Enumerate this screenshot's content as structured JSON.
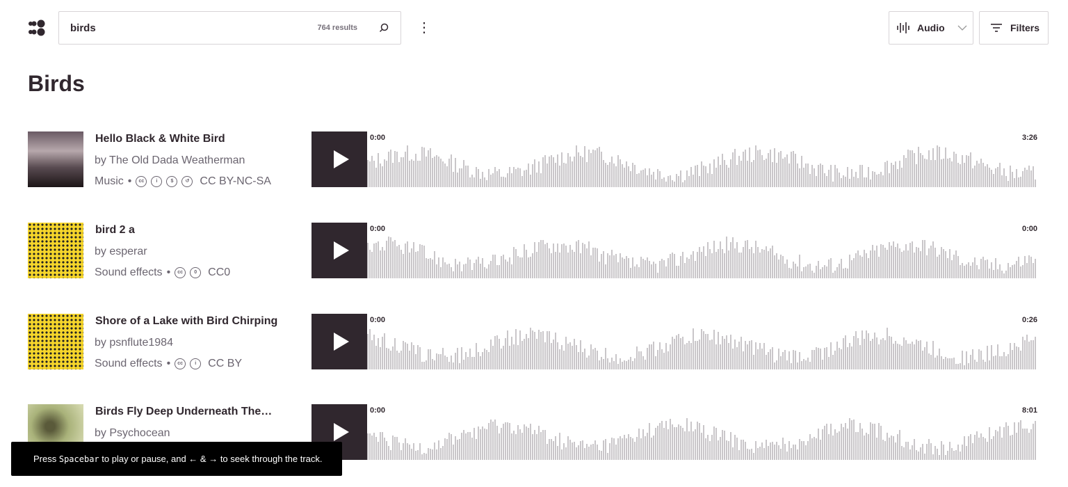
{
  "header": {
    "search_value": "birds",
    "result_count": "764 results",
    "content_type": "Audio",
    "filters_label": "Filters"
  },
  "page_title": "Birds",
  "tracks": [
    {
      "title": "Hello Black & White Bird",
      "by": "by The Old Dada Weatherman",
      "category": "Music",
      "license_icons": [
        "cc",
        "by",
        "nc",
        "sa"
      ],
      "license": "CC BY-NC-SA",
      "start": "0:00",
      "duration": "3:26"
    },
    {
      "title": "bird 2 a",
      "by": "by esperar",
      "category": "Sound effects",
      "license_icons": [
        "cc",
        "zero"
      ],
      "license": "CC0",
      "start": "0:00",
      "duration": "0:00"
    },
    {
      "title": "Shore of a Lake with Bird Chirping",
      "by": "by psnflute1984",
      "category": "Sound effects",
      "license_icons": [
        "cc",
        "by"
      ],
      "license": "CC BY",
      "start": "0:00",
      "duration": "0:26"
    },
    {
      "title": "Birds Fly Deep Underneath The…",
      "by": "by Psychocean",
      "start": "0:00",
      "duration": "8:01"
    }
  ],
  "toast": {
    "pre": "Press",
    "key": "Spacebar",
    "post": "to play or pause, and ← & → to seek through the track."
  }
}
